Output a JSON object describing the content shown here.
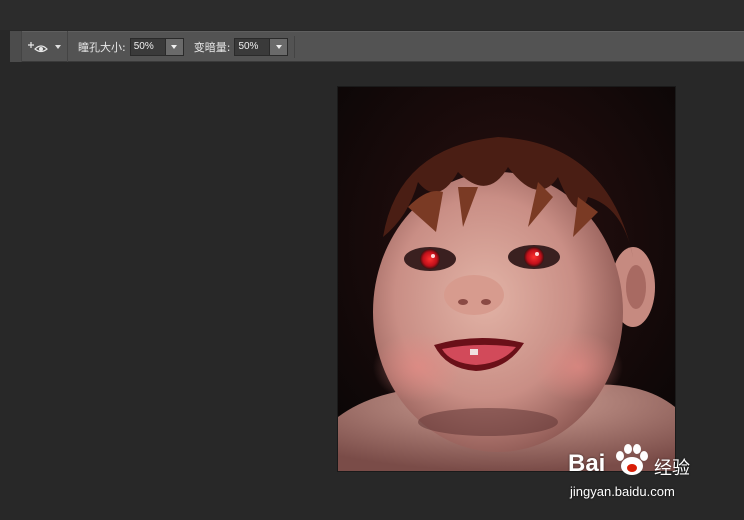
{
  "options_bar": {
    "tool_icon": "red-eye-tool-icon",
    "pupil_size": {
      "label": "瞳孔大小:",
      "value": "50%"
    },
    "darken_amount": {
      "label": "变暗量:",
      "value": "50%"
    }
  },
  "colors": {
    "workspace_bg": "#282828",
    "options_bar_bg": "#535353",
    "red_eye": "#d0141a"
  },
  "watermark": {
    "brand": "Bai",
    "brand_suffix": "经验",
    "paw_icon": "paw-icon",
    "url": "jingyan.baidu.com"
  }
}
